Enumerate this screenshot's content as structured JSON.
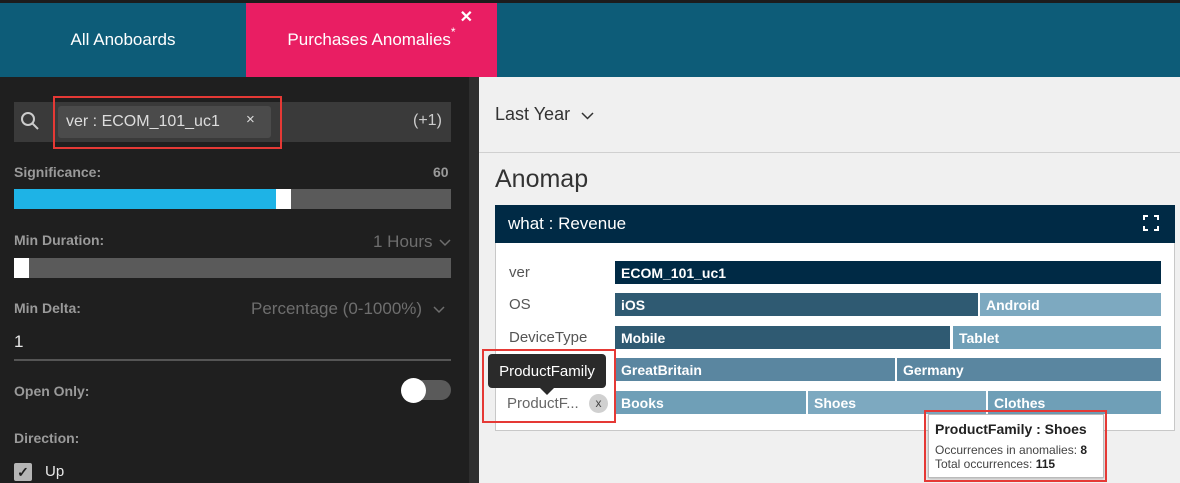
{
  "tabs": {
    "all": "All Anoboards",
    "active": "Purchases Anomalies",
    "active_mark": "*",
    "close": "✕"
  },
  "sidebar": {
    "search": {
      "chip": "ver : ECOM_101_uc1",
      "chip_remove": "×",
      "more": "(+1)"
    },
    "significance": {
      "label": "Significance:",
      "value": "60",
      "level_fraction": 0.6
    },
    "min_duration": {
      "label": "Min Duration:",
      "selected": "1 Hours",
      "level_fraction": 0.0
    },
    "min_delta": {
      "label": "Min Delta:",
      "selected": "Percentage (0-1000%)",
      "value": "1"
    },
    "open_only": {
      "label": "Open Only:",
      "on": false
    },
    "direction": {
      "label": "Direction:",
      "options": [
        {
          "label": "Up",
          "checked": true
        }
      ]
    }
  },
  "main": {
    "date_range": "Last Year",
    "title": "Anomap",
    "card": {
      "title": "what : Revenue",
      "rows": [
        {
          "label": "ver",
          "segments": [
            {
              "label": "ECOM_101_uc1",
              "color": "#002a45"
            }
          ]
        },
        {
          "label": "OS",
          "segments": [
            {
              "label": "iOS",
              "color": "#2f5a72"
            },
            {
              "label": "Android",
              "color": "#7da9c0"
            }
          ]
        },
        {
          "label": "DeviceType",
          "segments": [
            {
              "label": "Mobile",
              "color": "#2f5a72"
            },
            {
              "label": "Tablet",
              "color": "#6f9fb7"
            }
          ]
        },
        {
          "label": "",
          "segments": [
            {
              "label": "GreatBritain",
              "color": "#5a86a0"
            },
            {
              "label": "Germany",
              "color": "#5a86a0"
            }
          ]
        },
        {
          "label": "ProductF...",
          "segments": [
            {
              "label": "Books",
              "color": "#6f9fb7"
            },
            {
              "label": "Shoes",
              "color": "#7da9c0"
            },
            {
              "label": "Clothes",
              "color": "#6f9fb7"
            }
          ]
        }
      ],
      "label_tooltip": "ProductFamily",
      "row_remove": "x"
    },
    "hover_tooltip": {
      "title": "ProductFamily : Shoes",
      "occurrences_label": "Occurrences in anomalies:",
      "occurrences_value": "8",
      "total_label": "Total occurrences:",
      "total_value": "115"
    }
  }
}
